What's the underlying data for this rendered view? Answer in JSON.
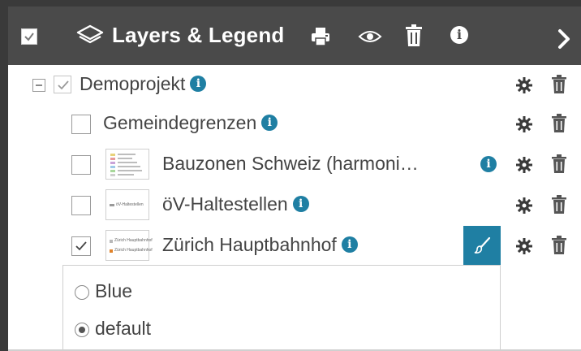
{
  "panel": {
    "title": "Layers & Legend",
    "accent_color": "#1f7fa3",
    "header_color": "#4a4a4a",
    "header_icons": [
      "select-all-checkbox",
      "layers-icon",
      "print-icon",
      "eye-icon",
      "trash-icon",
      "info-icon",
      "chevron-right-icon"
    ]
  },
  "tree": {
    "group": {
      "label": "Demoprojekt",
      "checked": true,
      "expanded": true
    },
    "layers": [
      {
        "label": "Gemeindegrenzen",
        "checked": false,
        "has_legend": false
      },
      {
        "label": "Bauzonen Schweiz (harmoni…",
        "checked": false,
        "has_legend": true
      },
      {
        "label": "öV-Haltestellen",
        "checked": false,
        "has_legend": true,
        "legend_text": "öV-Haltestellen"
      },
      {
        "label": "Zürich Hauptbahnhof",
        "checked": true,
        "has_legend": true,
        "legend_items": [
          "Zürich Hauptbahnhof",
          "Zürich Hauptbahnhof"
        ]
      }
    ]
  },
  "styles": {
    "options": [
      {
        "label": "Blue",
        "selected": false
      },
      {
        "label": "default",
        "selected": true
      }
    ]
  }
}
